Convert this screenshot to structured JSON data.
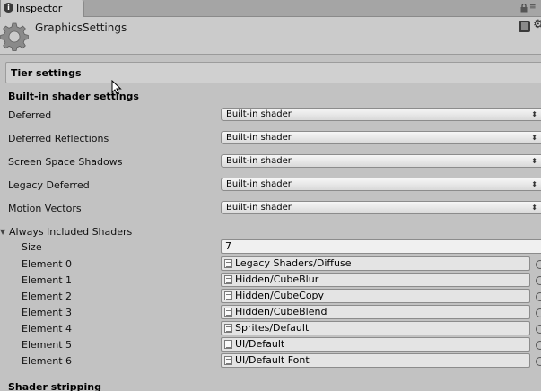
{
  "tab": {
    "label": "Inspector",
    "icon": "info-icon"
  },
  "header": {
    "title": "GraphicsSettings",
    "icon": "gear-icon"
  },
  "tier_settings": {
    "label": "Tier settings"
  },
  "builtin_section": {
    "title": "Built-in shader settings",
    "rows": [
      {
        "label": "Deferred",
        "value": "Built-in shader"
      },
      {
        "label": "Deferred Reflections",
        "value": "Built-in shader"
      },
      {
        "label": "Screen Space Shadows",
        "value": "Built-in shader"
      },
      {
        "label": "Legacy Deferred",
        "value": "Built-in shader"
      },
      {
        "label": "Motion Vectors",
        "value": "Built-in shader"
      }
    ]
  },
  "always_included": {
    "label": "Always Included Shaders",
    "size_label": "Size",
    "size_value": "7",
    "elements": [
      {
        "label": "Element 0",
        "value": "Legacy Shaders/Diffuse"
      },
      {
        "label": "Element 1",
        "value": "Hidden/CubeBlur"
      },
      {
        "label": "Element 2",
        "value": "Hidden/CubeCopy"
      },
      {
        "label": "Element 3",
        "value": "Hidden/CubeBlend"
      },
      {
        "label": "Element 4",
        "value": "Sprites/Default"
      },
      {
        "label": "Element 5",
        "value": "UI/Default"
      },
      {
        "label": "Element 6",
        "value": "UI/Default Font"
      }
    ]
  },
  "stripping_section": {
    "title": "Shader stripping"
  },
  "colors": {
    "panel_bg": "#c2c2c2",
    "tab_bg": "#cbcbcb"
  }
}
